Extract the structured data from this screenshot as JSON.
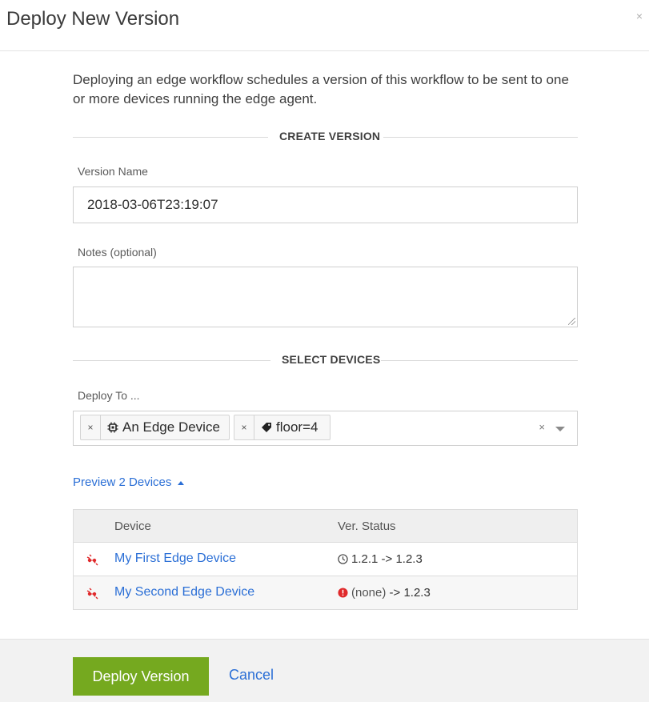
{
  "modal": {
    "title": "Deploy New Version",
    "close_label": "×"
  },
  "intro_text": "Deploying an edge workflow schedules a version of this workflow to be sent to one or more devices running the edge agent.",
  "sections": {
    "create_version": "CREATE VERSION",
    "select_devices": "SELECT DEVICES"
  },
  "form": {
    "version_name_label": "Version Name",
    "version_name_value": "2018-03-06T23:19:07",
    "notes_label": "Notes (optional)",
    "notes_value": "",
    "deploy_to_label": "Deploy To ...",
    "chips": [
      {
        "remove": "×",
        "icon": "chip-icon",
        "text": "An Edge Device"
      },
      {
        "remove": "×",
        "icon": "tag-icon",
        "text": "floor=4"
      }
    ],
    "clear_label": "×"
  },
  "preview": {
    "label": "Preview 2 Devices"
  },
  "table": {
    "columns": [
      "Device",
      "Ver. Status"
    ],
    "rows": [
      {
        "device": "My First Edge Device",
        "status_icon": "clock-icon",
        "status": "1.2.1 -> 1.2.3"
      },
      {
        "device": "My Second Edge Device",
        "status_icon": "error-icon",
        "status_prefix": "(none)",
        "status": " -> 1.2.3"
      }
    ]
  },
  "footer": {
    "deploy_label": "Deploy Version",
    "cancel_label": "Cancel"
  },
  "colors": {
    "accent_green": "#75a91f",
    "link_blue": "#2b6fd6",
    "error_red": "#e0292b",
    "disconnected_red": "#e0292b"
  }
}
